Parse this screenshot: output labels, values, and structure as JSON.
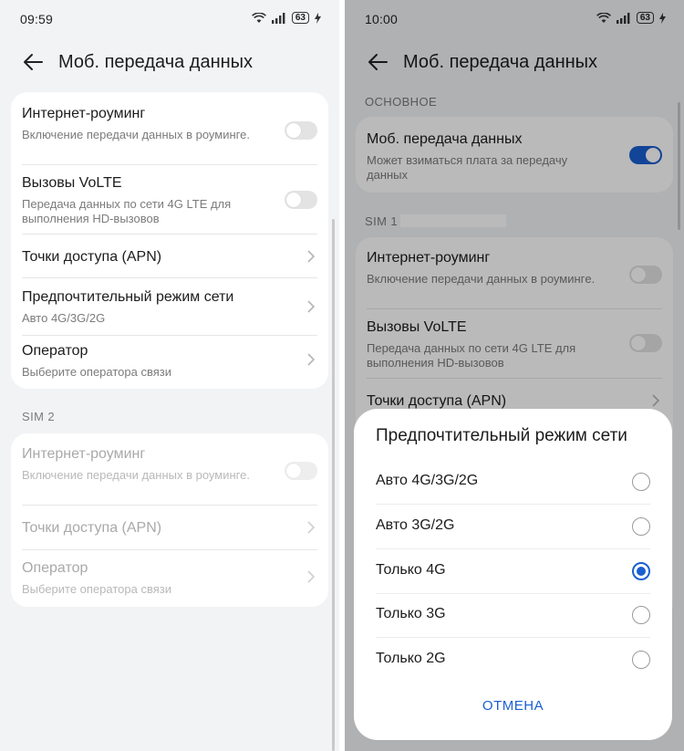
{
  "left": {
    "status": {
      "time": "09:59",
      "battery": "63"
    },
    "title": "Моб. передача данных",
    "sim1_items": [
      {
        "title": "Интернет-роуминг",
        "subtitle": "Включение передачи данных в роуминге."
      },
      {
        "title": "Вызовы VoLTE",
        "subtitle": "Передача данных по сети 4G LTE для выполнения HD-вызовов"
      },
      {
        "title": "Точки доступа (APN)"
      },
      {
        "title": "Предпочтительный режим сети",
        "subtitle": "Авто 4G/3G/2G"
      },
      {
        "title": "Оператор",
        "subtitle": "Выберите оператора связи"
      }
    ],
    "sim2_label": "SIM 2",
    "sim2_items": [
      {
        "title": "Интернет-роуминг",
        "subtitle": "Включение передачи данных в роуминге."
      },
      {
        "title": "Точки доступа (APN)"
      },
      {
        "title": "Оператор",
        "subtitle": "Выберите оператора связи"
      }
    ]
  },
  "right": {
    "status": {
      "time": "10:00",
      "battery": "63"
    },
    "title": "Моб. передача данных",
    "general_label": "ОСНОВНОЕ",
    "mobile_data": {
      "title": "Моб. передача данных",
      "subtitle": "Может взиматься плата за передачу данных",
      "enabled": true
    },
    "sim1_label": "SIM 1",
    "sim1_items": [
      {
        "title": "Интернет-роуминг",
        "subtitle": "Включение передачи данных в роумингe."
      },
      {
        "title": "Вызовы VoLTE",
        "subtitle": "Передача данных по сети 4G LTE для выполнения HD-вызовов"
      },
      {
        "title": "Точки доступа (APN)"
      }
    ],
    "dialog": {
      "title": "Предпочтительный режим сети",
      "options": [
        "Авто 4G/3G/2G",
        "Авто 3G/2G",
        "Только 4G",
        "Только 3G",
        "Только 2G"
      ],
      "selected": "Только 4G",
      "cancel": "ОТМЕНА"
    }
  },
  "colors": {
    "accent": "#1a5fd1",
    "background": "#f1f3f5",
    "card": "#ffffff"
  }
}
